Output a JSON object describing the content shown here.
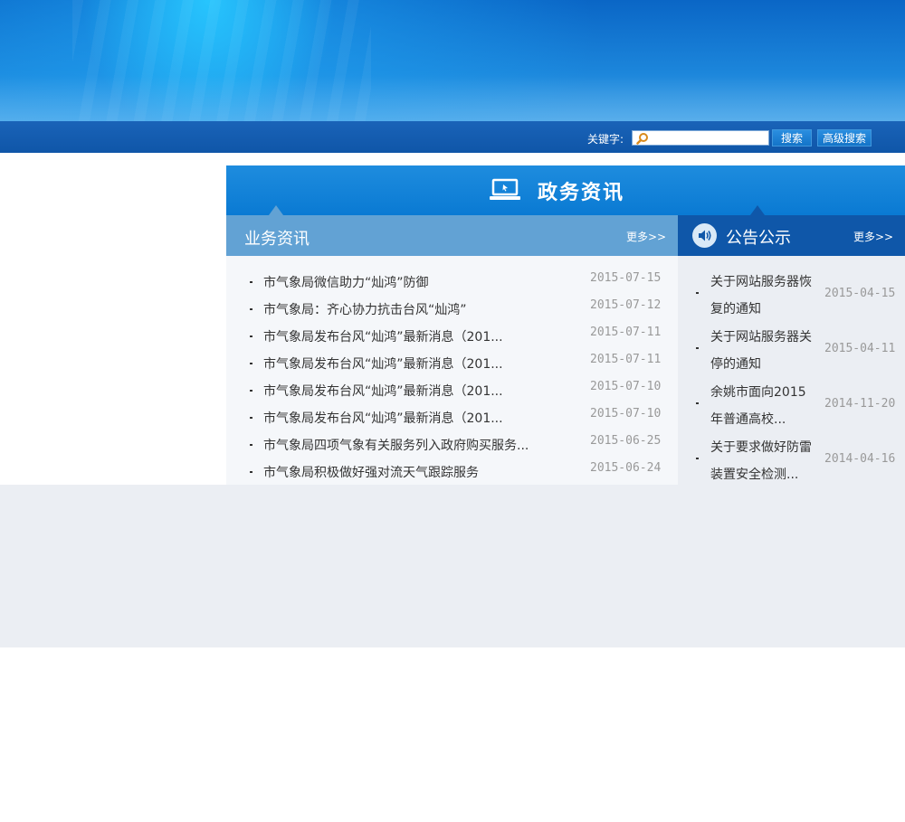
{
  "search": {
    "label": "关键字:",
    "placeholder": "",
    "value": "",
    "search_btn": "搜索",
    "advanced_btn": "高级搜索"
  },
  "gov_section": {
    "title": "政务资讯"
  },
  "business": {
    "title": "业务资讯",
    "more": "更多>>",
    "items": [
      {
        "title": "市气象局微信助力“灿鸿”防御",
        "date": "2015-07-15"
      },
      {
        "title": "市气象局：齐心协力抗击台风“灿鸿”",
        "date": "2015-07-12"
      },
      {
        "title": "市气象局发布台风“灿鸿”最新消息（201...",
        "date": "2015-07-11"
      },
      {
        "title": "市气象局发布台风“灿鸿”最新消息（201...",
        "date": "2015-07-11"
      },
      {
        "title": "市气象局发布台风“灿鸿”最新消息（201...",
        "date": "2015-07-10"
      },
      {
        "title": "市气象局发布台风“灿鸿”最新消息（201...",
        "date": "2015-07-10"
      },
      {
        "title": "市气象局四项气象有关服务列入政府购买服务...",
        "date": "2015-06-25"
      },
      {
        "title": "市气象局积极做好强对流天气跟踪服务",
        "date": "2015-06-24"
      }
    ]
  },
  "notice": {
    "title": "公告公示",
    "more": "更多>>",
    "items": [
      {
        "title": "关于网站服务器恢复的通知",
        "date": "2015-04-15"
      },
      {
        "title": "关于网站服务器关停的通知",
        "date": "2015-04-11"
      },
      {
        "title": "余姚市面向2015年普通高校...",
        "date": "2014-11-20"
      },
      {
        "title": "关于要求做好防雷装置安全检测...",
        "date": "2014-04-16"
      }
    ]
  }
}
